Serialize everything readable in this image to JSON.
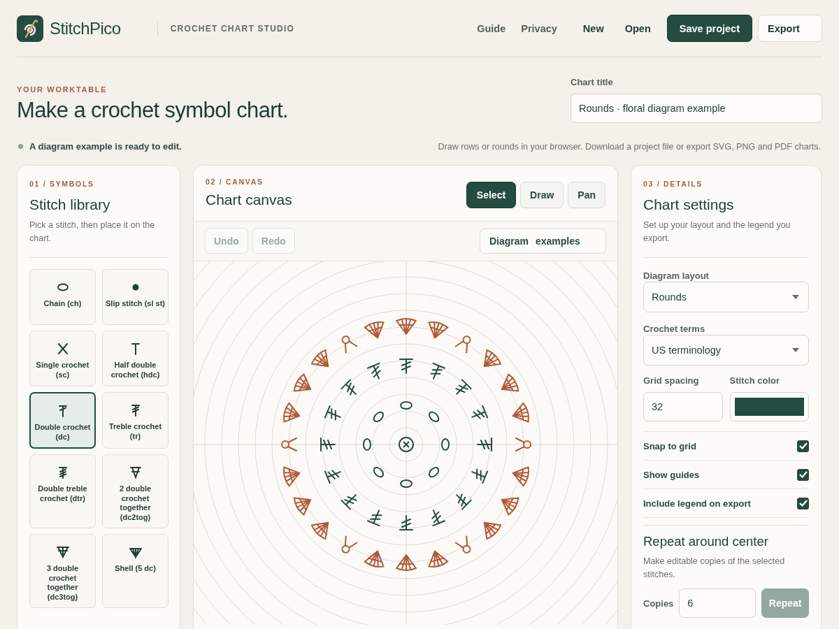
{
  "header": {
    "brand": "StitchPico",
    "tagline": "CROCHET CHART STUDIO",
    "nav_links": [
      "Guide",
      "Privacy"
    ],
    "actions": [
      {
        "label": "New",
        "kind": "plain"
      },
      {
        "label": "Open",
        "kind": "plain"
      },
      {
        "label": "Save project",
        "kind": "primary"
      },
      {
        "label": "Export",
        "kind": "outline"
      }
    ]
  },
  "hero": {
    "eyebrow": "YOUR WORKTABLE",
    "title": "Make a crochet symbol chart.",
    "chart_title": {
      "label": "Chart title",
      "value": "Rounds · floral diagram example"
    },
    "status": "A diagram example is ready to edit.",
    "note": "Draw rows or rounds in your browser. Download a project file or export SVG, PNG and PDF charts."
  },
  "symbols_panel": {
    "eyebrow": "01 / SYMBOLS",
    "title": "Stitch library",
    "description": "Pick a stitch, then place it on the chart.",
    "stitches": [
      {
        "label": "Chain (ch)",
        "kind": "chain",
        "selected": false
      },
      {
        "label": "Slip stitch (sl st)",
        "kind": "slip",
        "selected": false
      },
      {
        "label": "Single crochet (sc)",
        "kind": "sc",
        "selected": false
      },
      {
        "label": "Half double crochet (hdc)",
        "kind": "hdc",
        "selected": false
      },
      {
        "label": "Double crochet (dc)",
        "kind": "dc",
        "selected": true
      },
      {
        "label": "Treble crochet (tr)",
        "kind": "tr",
        "selected": false
      },
      {
        "label": "Double treble crochet (dtr)",
        "kind": "dtr",
        "selected": false
      },
      {
        "label": "2 double crochet together (dc2tog)",
        "kind": "dc2tog",
        "selected": false
      },
      {
        "label": "3 double crochet together (dc3tog)",
        "kind": "dc3tog",
        "selected": false
      },
      {
        "label": "Shell (5 dc)",
        "kind": "shell",
        "selected": false
      }
    ]
  },
  "canvas_panel": {
    "eyebrow": "02 / CANVAS",
    "title": "Chart canvas",
    "tools": [
      {
        "label": "Select",
        "selected": true
      },
      {
        "label": "Draw",
        "selected": false
      },
      {
        "label": "Pan",
        "selected": false
      }
    ],
    "history": [
      {
        "label": "Undo",
        "disabled": true
      },
      {
        "label": "Redo",
        "disabled": true
      }
    ],
    "examples_menu": "Diagram examples"
  },
  "details_panel": {
    "eyebrow": "03 / DETAILS",
    "title": "Chart settings",
    "description": "Set up your layout and the legend you export.",
    "layout": {
      "label": "Diagram layout",
      "value": "Rounds"
    },
    "terms": {
      "label": "Crochet terms",
      "value": "US terminology"
    },
    "grid_spacing": {
      "label": "Grid spacing",
      "value": "32"
    },
    "stitch_color": {
      "label": "Stitch color",
      "color": "#244c40"
    },
    "toggles": [
      {
        "label": "Snap to grid",
        "checked": true
      },
      {
        "label": "Show guides",
        "checked": true
      },
      {
        "label": "Include legend on export",
        "checked": true
      }
    ],
    "repeat": {
      "title": "Repeat around center",
      "description": "Make editable copies of the selected stitches.",
      "copies_label": "Copies",
      "copies_value": "6",
      "button": {
        "label": "Repeat",
        "disabled": true
      }
    }
  }
}
